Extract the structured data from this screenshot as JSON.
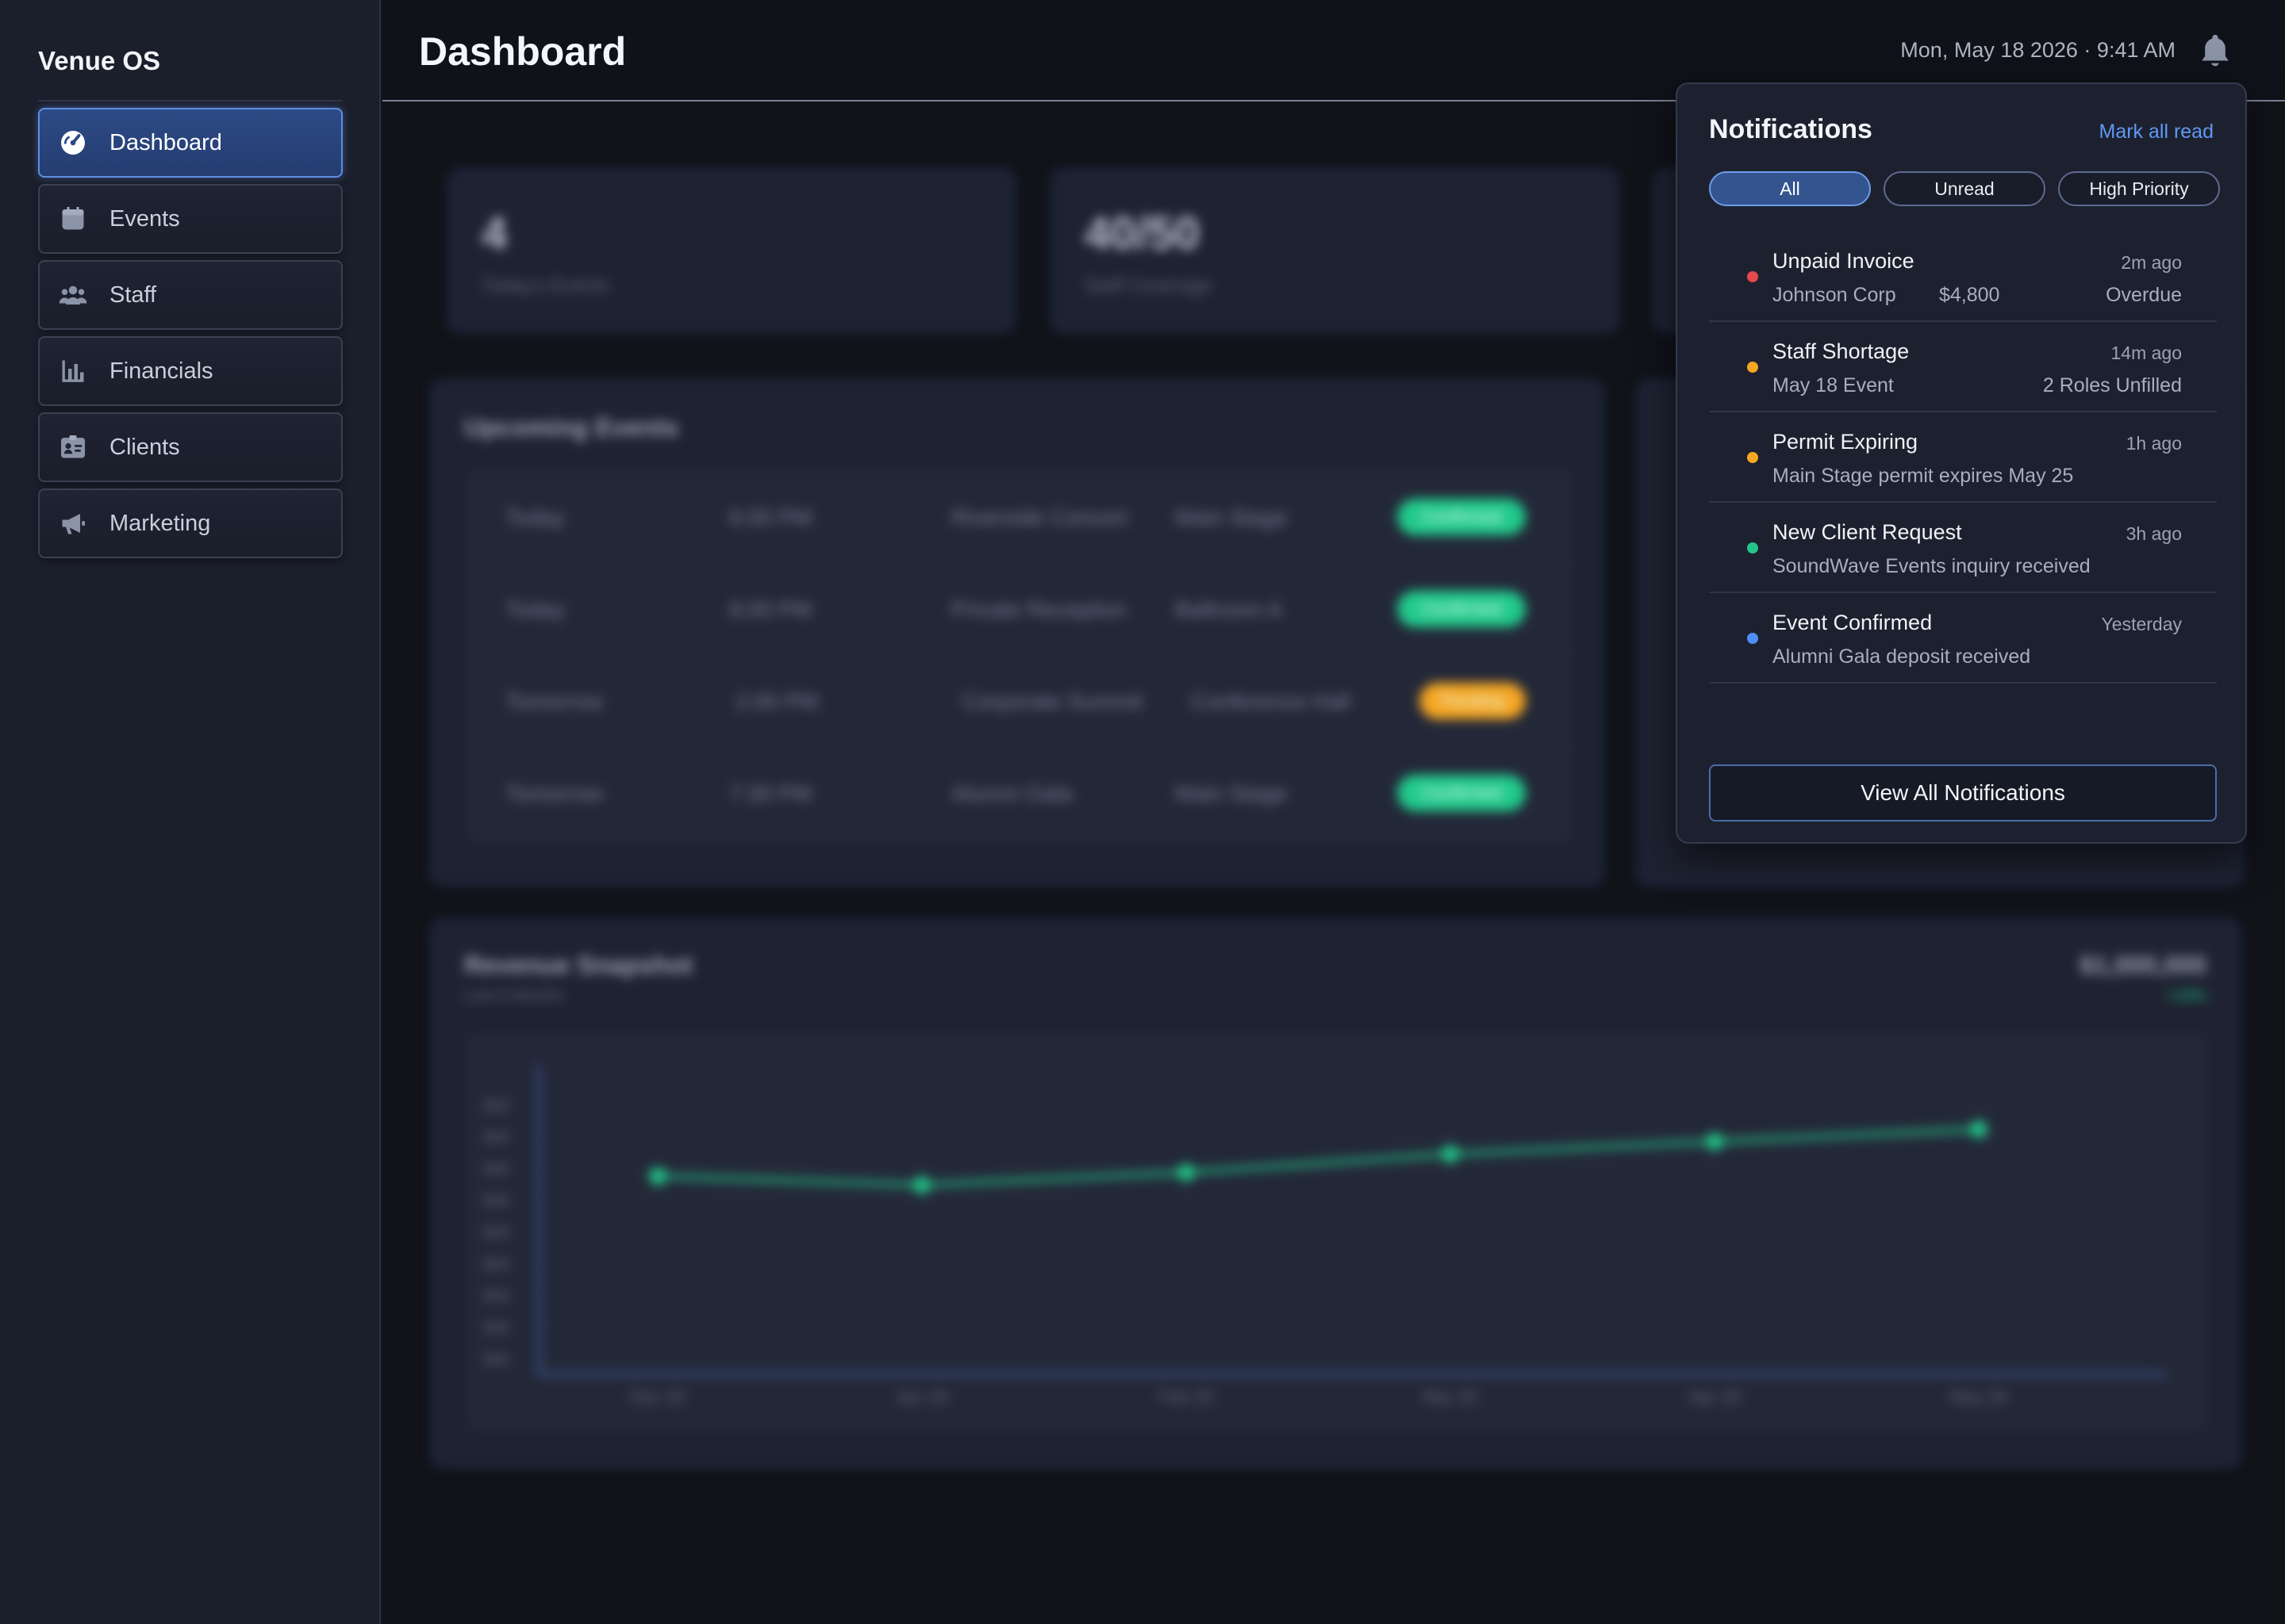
{
  "app": {
    "name": "Venue OS"
  },
  "sidebar": {
    "items": [
      {
        "label": "Dashboard",
        "icon": "gauge-icon",
        "active": true
      },
      {
        "label": "Events",
        "icon": "calendar-icon",
        "active": false
      },
      {
        "label": "Staff",
        "icon": "users-icon",
        "active": false
      },
      {
        "label": "Financials",
        "icon": "bar-chart-icon",
        "active": false
      },
      {
        "label": "Clients",
        "icon": "id-card-icon",
        "active": false
      },
      {
        "label": "Marketing",
        "icon": "megaphone-icon",
        "active": false
      }
    ]
  },
  "header": {
    "title": "Dashboard",
    "datetime": "Mon, May 18 2026 · 9:41 AM",
    "bell_icon": "bell-icon"
  },
  "background": {
    "stats": [
      {
        "value": "4",
        "label": "Today's Events"
      },
      {
        "value": "40/50",
        "label": "Staff Coverage"
      }
    ],
    "upcoming": {
      "title": "Upcoming Events",
      "rows": [
        {
          "day": "Today",
          "time": "6:00 PM",
          "event": "Riverside Concert",
          "room": "Main Stage",
          "status": "Confirmed"
        },
        {
          "day": "Today",
          "time": "8:00 PM",
          "event": "Private Reception",
          "room": "Ballroom A",
          "status": "Confirmed"
        },
        {
          "day": "Tomorrow",
          "time": "2:00 PM",
          "event": "Corporate Summit",
          "room": "Conference Hall",
          "status": "Pending"
        },
        {
          "day": "Tomorrow",
          "time": "7:30 PM",
          "event": "Alumni Gala",
          "room": "Main Stage",
          "status": "Confirmed"
        }
      ]
    },
    "revenue": {
      "title": "Revenue Snapshot",
      "subtitle": "Last 6 Months",
      "total": "$1,000,000",
      "change": "+10%"
    }
  },
  "chart_data": {
    "type": "line",
    "categories": [
      "Dec 25",
      "Jan 26",
      "Feb 26",
      "Mar 26",
      "Apr 26",
      "May 26"
    ],
    "series": [
      {
        "values": [
          160,
          153,
          163,
          178,
          188,
          198
        ],
        "color": "#22c68a"
      }
    ],
    "yticks": [
      "$0K",
      "$0K",
      "$0K",
      "$0K",
      "$0K",
      "$0K",
      "$0K",
      "$0K",
      "$0K"
    ],
    "ylim": [
      0,
      250
    ]
  },
  "notifications": {
    "title": "Notifications",
    "mark_all": "Mark all read",
    "filters": [
      {
        "label": "All",
        "active": true
      },
      {
        "label": "Unread",
        "active": false
      },
      {
        "label": "High Priority",
        "active": false
      }
    ],
    "items": [
      {
        "title": "Unpaid Invoice",
        "time": "2m ago",
        "sub": "Johnson Corp",
        "amount": "$4,800",
        "right": "Overdue",
        "color": "#e5484d"
      },
      {
        "title": "Staff Shortage",
        "time": "14m ago",
        "sub": "May 18 Event",
        "amount": "",
        "right": "2 Roles Unfilled",
        "color": "#f5a623"
      },
      {
        "title": "Permit Expiring",
        "time": "1h ago",
        "sub": "Main Stage permit expires May 25",
        "amount": "",
        "right": "",
        "color": "#f5a623"
      },
      {
        "title": "New Client Request",
        "time": "3h ago",
        "sub": "SoundWave Events inquiry received",
        "amount": "",
        "right": "",
        "color": "#22c68a"
      },
      {
        "title": "Event Confirmed",
        "time": "Yesterday",
        "sub": "Alumni Gala deposit received",
        "amount": "",
        "right": "",
        "color": "#4f8ef7"
      }
    ],
    "view_all": "View All Notifications"
  }
}
